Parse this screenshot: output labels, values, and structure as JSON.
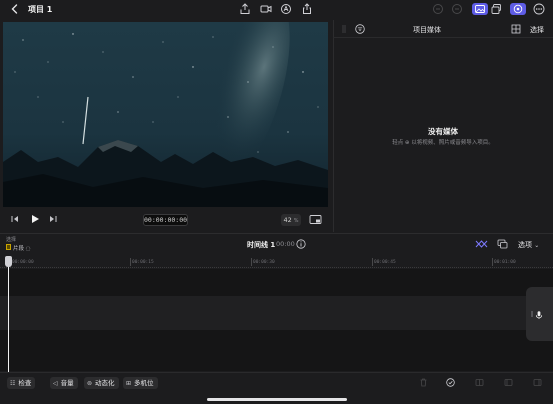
{
  "header": {
    "title": "项目 1"
  },
  "viewer": {
    "timecode": "00:00:00:00",
    "zoom_value": "42",
    "zoom_unit": "%"
  },
  "media_panel": {
    "title": "项目媒体",
    "select_label": "选择",
    "empty_title": "没有媒体",
    "empty_hint": "轻点 ⊕ 以将视频、照片或音频导入项目。"
  },
  "timeline": {
    "small_label": "选择",
    "clip_label": "片段 ◌",
    "name": "时间线 1",
    "duration": "00:00",
    "options_label": "选项",
    "ruler_ticks": [
      "00:00:00",
      "00:00:15",
      "00:00:30",
      "00:00:45",
      "00:01:00"
    ]
  },
  "toolbar": {
    "inspect": "检查",
    "volume": "音量",
    "animate": "动态化",
    "multicam": "多机位"
  },
  "colors": {
    "accent": "#5e5ce6",
    "background": "#1c1c1e"
  }
}
